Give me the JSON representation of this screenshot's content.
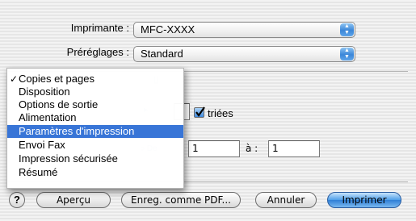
{
  "printer": {
    "label": "Imprimante :",
    "value": "MFC-XXXX"
  },
  "presets": {
    "label": "Préréglages :",
    "value": "Standard"
  },
  "menu": {
    "items": [
      {
        "label": "Copies et pages",
        "checked": true
      },
      {
        "label": "Disposition"
      },
      {
        "label": "Options de sortie"
      },
      {
        "label": "Alimentation"
      },
      {
        "label": "Paramètres d'impression",
        "selected": true
      },
      {
        "label": "Envoi Fax"
      },
      {
        "label": "Impression sécurisée"
      },
      {
        "label": "Résumé"
      }
    ]
  },
  "copies": {
    "collated_label": "triées",
    "collated_checked": true
  },
  "pages": {
    "from_value": "1",
    "to_label": "à :",
    "to_value": "1"
  },
  "buttons": {
    "help": "?",
    "preview": "Aperçu",
    "save_pdf": "Enreg. comme PDF...",
    "cancel": "Annuler",
    "print": "Imprimer"
  }
}
